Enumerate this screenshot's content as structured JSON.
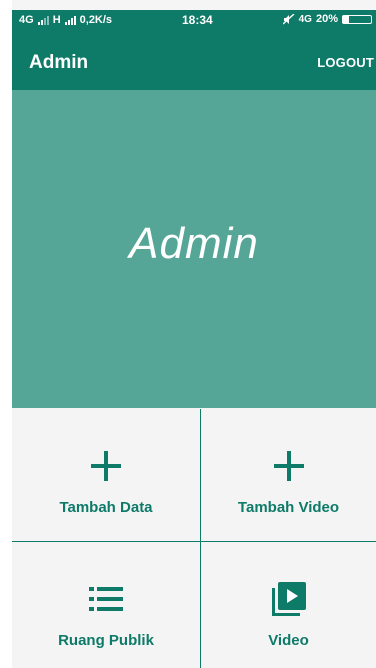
{
  "status_bar": {
    "network_left": "4G",
    "network_mid": "H",
    "speed": "0,2K/s",
    "time": "18:34",
    "network_right": "4G",
    "battery": "20%",
    "battery_level": 0.2
  },
  "app_bar": {
    "title": "Admin",
    "logout_label": "LOGOUT"
  },
  "hero": {
    "title": "Admin"
  },
  "menu": [
    {
      "label": "Tambah Data",
      "icon": "plus-icon"
    },
    {
      "label": "Tambah Video",
      "icon": "plus-icon"
    },
    {
      "label": "Ruang Publik",
      "icon": "list-icon"
    },
    {
      "label": "Video",
      "icon": "video-library-icon"
    }
  ],
  "colors": {
    "primary": "#0e7a68",
    "hero": "#56a698",
    "grid_bg": "#f4f4f4"
  }
}
